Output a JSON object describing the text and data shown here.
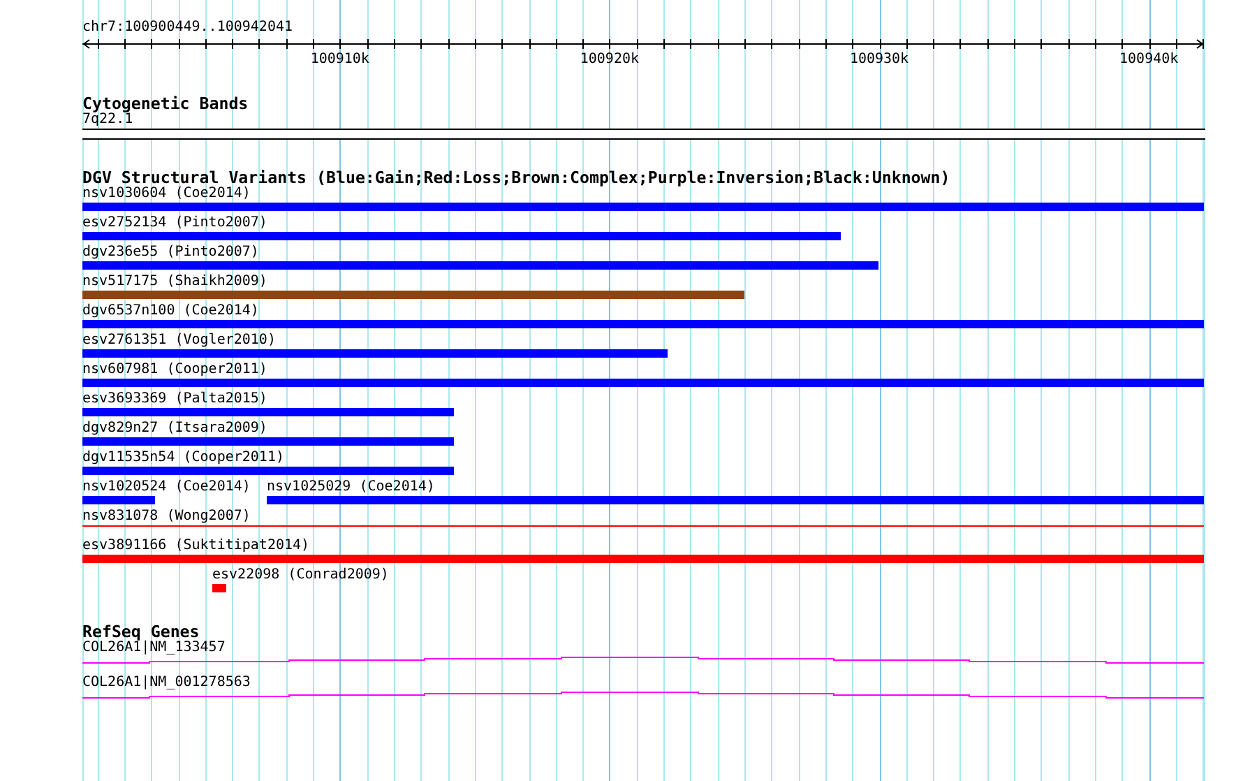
{
  "ruler": {
    "region": "chr7:100900449..100942041",
    "ticks": [
      "100910k",
      "100920k",
      "100930k",
      "100940k"
    ]
  },
  "cytogenetic_track": {
    "title": "Cytogenetic Bands",
    "band": "7q22.1"
  },
  "dgv_track": {
    "title": "DGV Structural Variants (Blue:Gain;Red:Loss;Brown:Complex;Purple:Inversion;Black:Unknown)",
    "rows": [
      {
        "features": [
          {
            "label": "nsv1030604 (Coe2014)",
            "color": "#0000ff",
            "kind": "bar"
          }
        ]
      },
      {
        "features": [
          {
            "label": "esv2752134 (Pinto2007)",
            "color": "#0000ff",
            "kind": "bar"
          }
        ]
      },
      {
        "features": [
          {
            "label": "dgv236e55 (Pinto2007)",
            "color": "#0000ff",
            "kind": "bar"
          }
        ]
      },
      {
        "features": [
          {
            "label": "nsv517175 (Shaikh2009)",
            "color": "#8b4513",
            "kind": "bar"
          }
        ]
      },
      {
        "features": [
          {
            "label": "dgv6537n100 (Coe2014)",
            "color": "#0000ff",
            "kind": "bar"
          }
        ]
      },
      {
        "features": [
          {
            "label": "esv2761351 (Vogler2010)",
            "color": "#0000ff",
            "kind": "bar"
          }
        ]
      },
      {
        "features": [
          {
            "label": "nsv607981 (Cooper2011)",
            "color": "#0000ff",
            "kind": "bar"
          }
        ]
      },
      {
        "features": [
          {
            "label": "esv3693369 (Palta2015)",
            "color": "#0000ff",
            "kind": "bar"
          }
        ]
      },
      {
        "features": [
          {
            "label": "dgv829n27 (Itsara2009)",
            "color": "#0000ff",
            "kind": "bar"
          }
        ]
      },
      {
        "features": [
          {
            "label": "dgv11535n54 (Cooper2011)",
            "color": "#0000ff",
            "kind": "bar"
          }
        ]
      },
      {
        "features": [
          {
            "label": "nsv1020524 (Coe2014)",
            "color": "#0000ff",
            "kind": "bar"
          },
          {
            "label": "nsv1025029 (Coe2014)",
            "color": "#0000ff",
            "kind": "bar"
          }
        ]
      },
      {
        "features": [
          {
            "label": "nsv831078 (Wong2007)",
            "color": "#ff0000",
            "kind": "line"
          }
        ]
      },
      {
        "features": [
          {
            "label": "esv3891166 (Suktitipat2014)",
            "color": "#ff0000",
            "kind": "bar"
          }
        ]
      },
      {
        "features": [
          {
            "label": "esv22098 (Conrad2009)",
            "color": "#ff0000",
            "kind": "bar"
          }
        ]
      }
    ]
  },
  "refseq_track": {
    "title": "RefSeq Genes",
    "genes": [
      {
        "label": "COL26A1|NM_133457"
      },
      {
        "label": "COL26A1|NM_001278563"
      }
    ]
  }
}
